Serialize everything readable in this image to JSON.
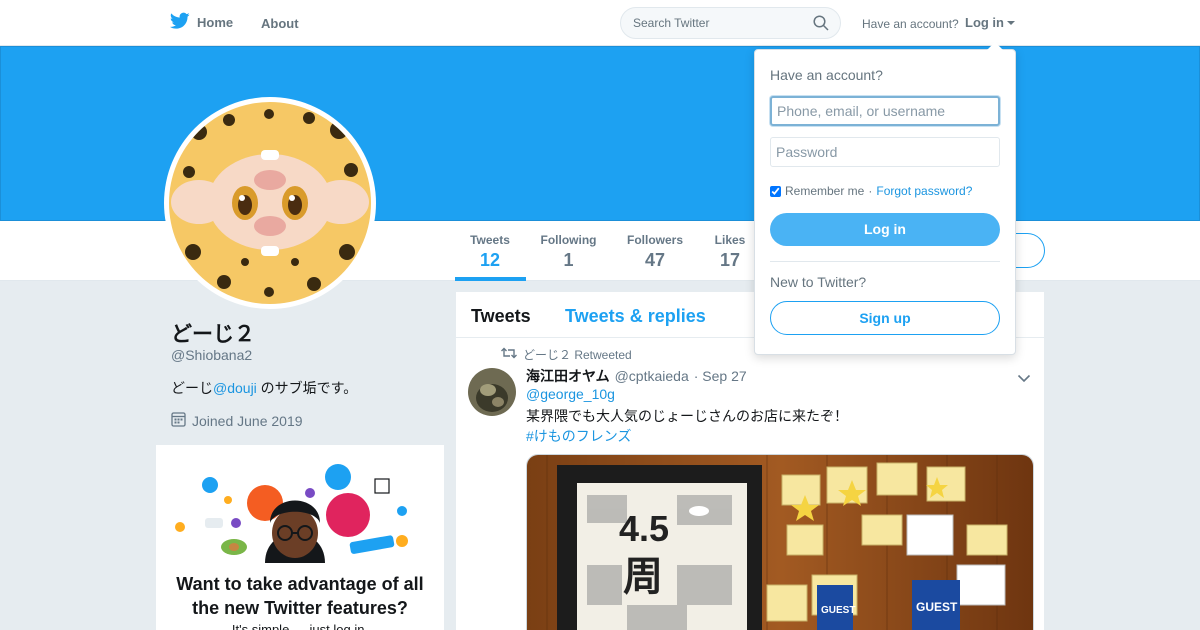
{
  "nav": {
    "home_label": "Home",
    "about_label": "About",
    "search_placeholder": "Search Twitter",
    "have_account": "Have an account?",
    "login_label": "Log in"
  },
  "profile": {
    "name": "どーじ２",
    "handle": "@Shiobana2",
    "bio_prefix": "どーじ",
    "bio_mention": "@douji",
    "bio_suffix": " のサブ垢です。",
    "joined": "Joined June 2019"
  },
  "stats": [
    {
      "label": "Tweets",
      "value": "12"
    },
    {
      "label": "Following",
      "value": "1"
    },
    {
      "label": "Followers",
      "value": "47"
    },
    {
      "label": "Likes",
      "value": "17"
    }
  ],
  "timeline": {
    "tab_tweets": "Tweets",
    "tab_replies": "Tweets & replies",
    "retweeted_by": "どーじ２ Retweeted",
    "tweet": {
      "author_name": "海江田オヤム",
      "author_handle": "@cptkaieda",
      "date": "· Sep 27",
      "mention": "@george_10g",
      "text": "某界隈でも大人気のじょーじさんのお店に来たぞ！",
      "hashtag": "#けものフレンズ",
      "media_caption_1": "4.5",
      "media_caption_2": "周",
      "media_badge_1": "GUEST",
      "media_badge_2": "GUEST"
    }
  },
  "promo": {
    "title": "Want to take advantage of all the new Twitter features?",
    "subtitle": "It's simple — just log in."
  },
  "login_dropdown": {
    "title": "Have an account?",
    "username_placeholder": "Phone, email, or username",
    "password_placeholder": "Password",
    "remember_me": "Remember me",
    "separator": " · ",
    "forgot_password": "Forgot password?",
    "login_button": "Log in",
    "new_to_twitter": "New to Twitter?",
    "signup_button": "Sign up"
  },
  "colors": {
    "brand": "#1da1f2",
    "link": "#1b95e0",
    "muted": "#657786"
  }
}
